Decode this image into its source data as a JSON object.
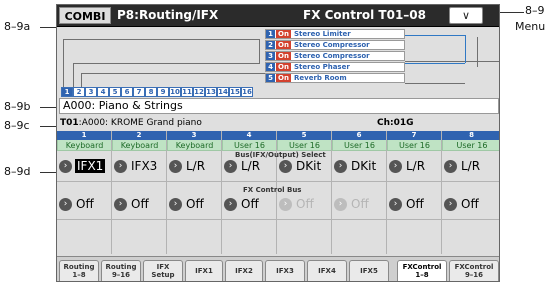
{
  "annotations": {
    "a": "8–9a",
    "b": "8–9b",
    "c": "8–9c",
    "d": "8–9d",
    "menu_num": "8–9",
    "menu_word": "Menu"
  },
  "header": {
    "mode": "COMBI",
    "page": "P8:Routing/IFX",
    "fx_title": "FX Control T01–08",
    "menu_glyph": "∨"
  },
  "ifx_chain": [
    {
      "num": "1",
      "on": "On",
      "name": "Stereo Limiter"
    },
    {
      "num": "2",
      "on": "On",
      "name": "Stereo Compressor"
    },
    {
      "num": "3",
      "on": "On",
      "name": "Stereo Compressor"
    },
    {
      "num": "4",
      "on": "On",
      "name": "Stereo Phaser"
    },
    {
      "num": "5",
      "on": "On",
      "name": "Reverb Room"
    }
  ],
  "timbre_numbers": [
    "1",
    "2",
    "3",
    "4",
    "5",
    "6",
    "7",
    "8",
    "9",
    "10",
    "11",
    "12",
    "13",
    "14",
    "15",
    "16"
  ],
  "program": "A000: Piano & Strings",
  "timbre": {
    "id": "T01",
    "program": ":A000: KROME Grand piano",
    "channel": "Ch:01G"
  },
  "captions": {
    "bus_select": "Bus(IFX/Output) Select",
    "fx_control_bus": "FX Control Bus"
  },
  "columns": [
    {
      "num": "1",
      "type": "Keyboard",
      "bus": "IFX1",
      "fx": "Off"
    },
    {
      "num": "2",
      "type": "Keyboard",
      "bus": "IFX3",
      "fx": "Off"
    },
    {
      "num": "3",
      "type": "Keyboard",
      "bus": "L/R",
      "fx": "Off"
    },
    {
      "num": "4",
      "type": "User 16",
      "bus": "L/R",
      "fx": "Off"
    },
    {
      "num": "5",
      "type": "User 16",
      "bus": "DKit",
      "fx": "Off"
    },
    {
      "num": "6",
      "type": "User 16",
      "bus": "DKit",
      "fx": "Off"
    },
    {
      "num": "7",
      "type": "User 16",
      "bus": "L/R",
      "fx": "Off"
    },
    {
      "num": "8",
      "type": "User 16",
      "bus": "L/R",
      "fx": "Off"
    }
  ],
  "tabs": [
    {
      "top": "Routing",
      "bottom": "1–8"
    },
    {
      "top": "Routing",
      "bottom": "9–16"
    },
    {
      "top": "IFX",
      "bottom": "Setup"
    },
    {
      "top": "IFX1",
      "bottom": ""
    },
    {
      "top": "IFX2",
      "bottom": ""
    },
    {
      "top": "IFX3",
      "bottom": ""
    },
    {
      "top": "IFX4",
      "bottom": ""
    },
    {
      "top": "IFX5",
      "bottom": ""
    },
    {
      "top": "FXControl",
      "bottom": "1–8"
    },
    {
      "top": "FXControl",
      "bottom": "9–16"
    }
  ],
  "colors": {
    "accent_blue": "#2f63b0",
    "on_red": "#d3412e",
    "keyboard_green": "#bfe3c4"
  }
}
